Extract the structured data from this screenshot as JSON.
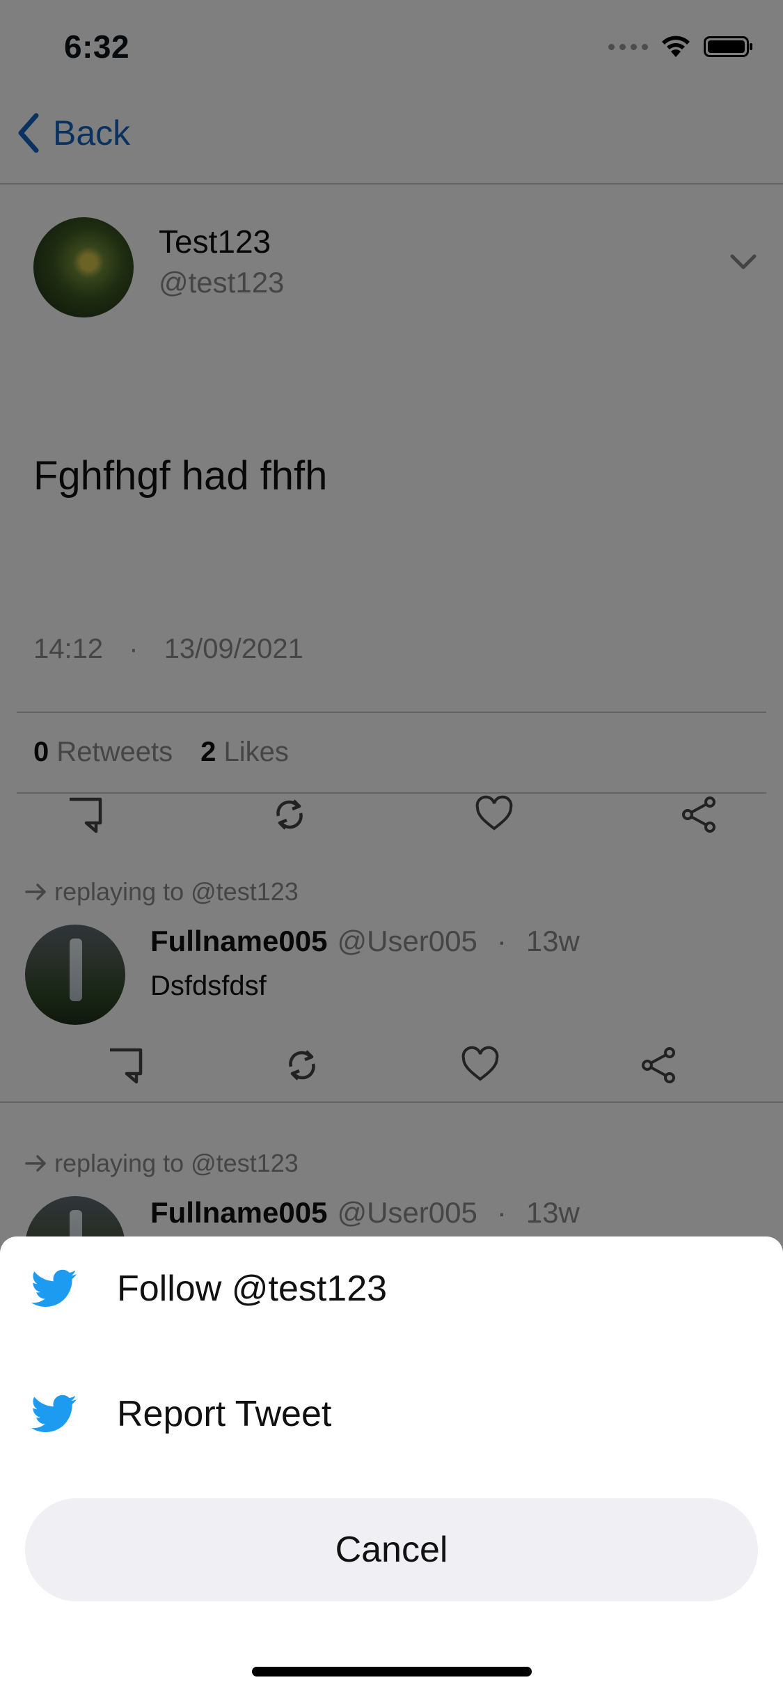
{
  "status_bar": {
    "time": "6:32"
  },
  "nav": {
    "back_label": "Back"
  },
  "tweet": {
    "name": "Test123",
    "handle": "@test123",
    "text": "Fghfhgf had fhfh",
    "time": "14:12",
    "separator": "·",
    "date": "13/09/2021",
    "retweets_count": "0",
    "retweets_label": "Retweets",
    "likes_count": "2",
    "likes_label": "Likes"
  },
  "replies": [
    {
      "context": "replaying to @test123",
      "name": "Fullname005",
      "handle": "@User005",
      "dot": "·",
      "age": "13w",
      "text": "Dsfdsfdsf"
    },
    {
      "context": "replaying to @test123",
      "name": "Fullname005",
      "handle": "@User005",
      "dot": "·",
      "age": "13w"
    }
  ],
  "sheet": {
    "items": [
      {
        "label": "Follow @test123",
        "icon": "twitter-bird-icon"
      },
      {
        "label": "Report Tweet",
        "icon": "twitter-bird-icon"
      }
    ],
    "cancel_label": "Cancel"
  },
  "colors": {
    "accent": "#1d9bf0",
    "link": "#1565c0",
    "overlay": "rgba(0,0,0,0.5)"
  }
}
